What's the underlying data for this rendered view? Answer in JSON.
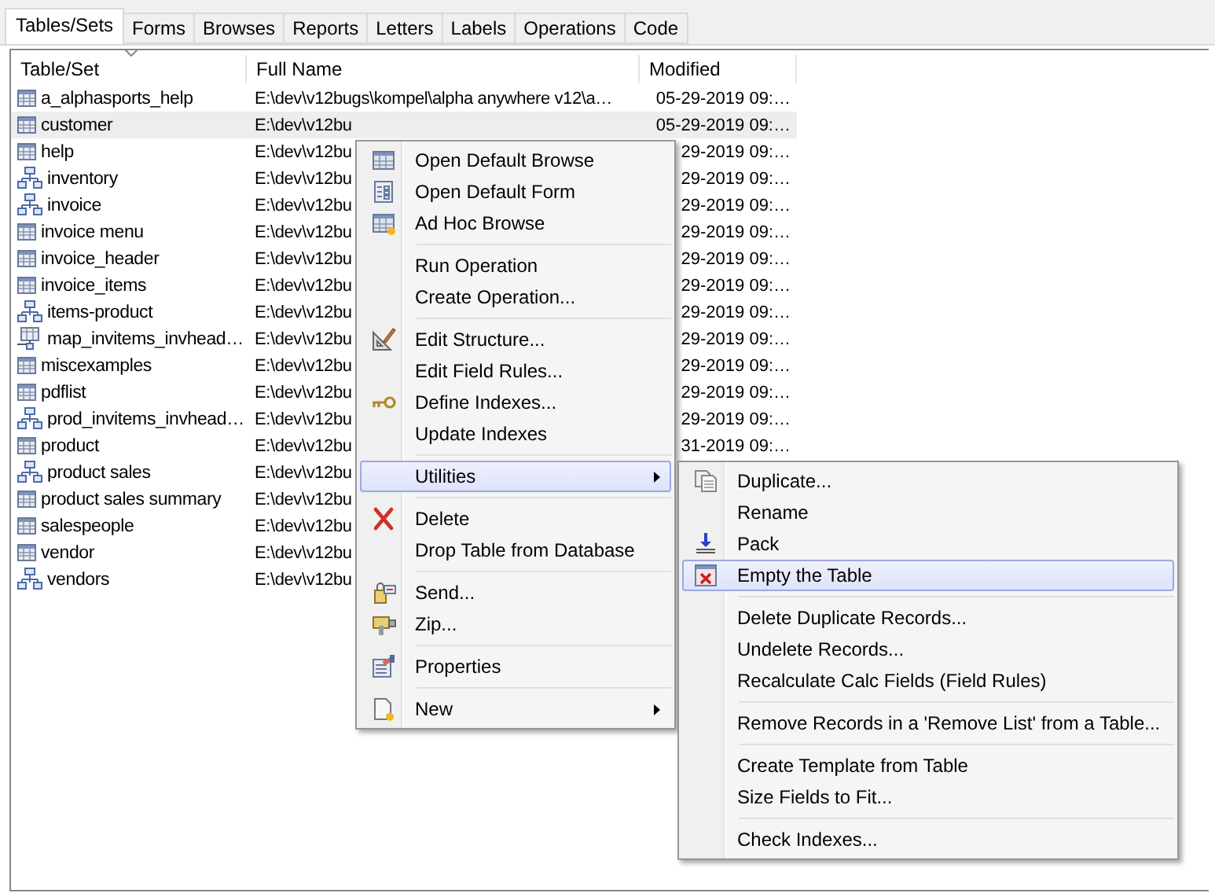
{
  "tabs": [
    {
      "label": "Tables/Sets",
      "selected": true
    },
    {
      "label": "Forms",
      "selected": false
    },
    {
      "label": "Browses",
      "selected": false
    },
    {
      "label": "Reports",
      "selected": false
    },
    {
      "label": "Letters",
      "selected": false
    },
    {
      "label": "Labels",
      "selected": false
    },
    {
      "label": "Operations",
      "selected": false
    },
    {
      "label": "Code",
      "selected": false
    }
  ],
  "table": {
    "columns": [
      "Table/Set",
      "Full Name",
      "Modified"
    ],
    "rows": [
      {
        "kind": "table",
        "name": "a_alphasports_help",
        "full_name": "E:\\dev\\v12bugs\\kompel\\alpha anywhere v12\\a…",
        "modified": "05-29-2019 09:…",
        "selected": false
      },
      {
        "kind": "table",
        "name": "customer",
        "full_name": "E:\\dev\\v12bu",
        "modified": "05-29-2019 09:…",
        "selected": true
      },
      {
        "kind": "table",
        "name": "help",
        "full_name": "E:\\dev\\v12bu",
        "modified": "29-2019 09:…",
        "selected": false
      },
      {
        "kind": "set",
        "name": "inventory",
        "full_name": "E:\\dev\\v12bu",
        "modified": "29-2019 09:…",
        "selected": false
      },
      {
        "kind": "set",
        "name": "invoice",
        "full_name": "E:\\dev\\v12bu",
        "modified": "29-2019 09:…",
        "selected": false
      },
      {
        "kind": "table",
        "name": "invoice menu",
        "full_name": "E:\\dev\\v12bu",
        "modified": "29-2019 09:…",
        "selected": false
      },
      {
        "kind": "table",
        "name": "invoice_header",
        "full_name": "E:\\dev\\v12bu",
        "modified": "29-2019 09:…",
        "selected": false
      },
      {
        "kind": "table",
        "name": "invoice_items",
        "full_name": "E:\\dev\\v12bu",
        "modified": "29-2019 09:…",
        "selected": false
      },
      {
        "kind": "set",
        "name": "items-product",
        "full_name": "E:\\dev\\v12bu",
        "modified": "29-2019 09:…",
        "selected": false
      },
      {
        "kind": "map",
        "name": "map_invitems_invhead…",
        "full_name": "E:\\dev\\v12bu",
        "modified": "29-2019 09:…",
        "selected": false
      },
      {
        "kind": "table",
        "name": "miscexamples",
        "full_name": "E:\\dev\\v12bu",
        "modified": "29-2019 09:…",
        "selected": false
      },
      {
        "kind": "table",
        "name": "pdflist",
        "full_name": "E:\\dev\\v12bu",
        "modified": "29-2019 09:…",
        "selected": false
      },
      {
        "kind": "set",
        "name": "prod_invitems_invhead…",
        "full_name": "E:\\dev\\v12bu",
        "modified": "29-2019 09:…",
        "selected": false
      },
      {
        "kind": "table",
        "name": "product",
        "full_name": "E:\\dev\\v12bu",
        "modified": "31-2019 09:…",
        "selected": false
      },
      {
        "kind": "set",
        "name": "product sales",
        "full_name": "E:\\dev\\v12bu",
        "selected": false
      },
      {
        "kind": "table",
        "name": "product sales summary",
        "full_name": "E:\\dev\\v12bu",
        "selected": false
      },
      {
        "kind": "table",
        "name": "salespeople",
        "full_name": "E:\\dev\\v12bu",
        "selected": false
      },
      {
        "kind": "table",
        "name": "vendor",
        "full_name": "E:\\dev\\v12bu",
        "selected": false
      },
      {
        "kind": "set",
        "name": "vendors",
        "full_name": "E:\\dev\\v12bu",
        "selected": false
      }
    ]
  },
  "context_menu": {
    "groups": [
      [
        {
          "label": "Open Default Browse",
          "selected": false,
          "submenu": false
        },
        {
          "label": "Open Default Form",
          "selected": false,
          "submenu": false
        },
        {
          "label": "Ad Hoc Browse",
          "selected": false,
          "submenu": false
        }
      ],
      [
        {
          "label": "Run Operation",
          "selected": false,
          "submenu": false
        },
        {
          "label": "Create Operation...",
          "selected": false,
          "submenu": false
        }
      ],
      [
        {
          "label": "Edit Structure...",
          "selected": false,
          "submenu": false
        },
        {
          "label": "Edit Field Rules...",
          "selected": false,
          "submenu": false
        },
        {
          "label": "Define Indexes...",
          "selected": false,
          "submenu": false
        },
        {
          "label": "Update Indexes",
          "selected": false,
          "submenu": false
        }
      ],
      [
        {
          "label": "Utilities",
          "selected": true,
          "submenu": true
        }
      ],
      [
        {
          "label": "Delete",
          "selected": false,
          "submenu": false
        },
        {
          "label": "Drop Table from Database",
          "selected": false,
          "submenu": false
        }
      ],
      [
        {
          "label": "Send...",
          "selected": false,
          "submenu": false
        },
        {
          "label": "Zip...",
          "selected": false,
          "submenu": false
        }
      ],
      [
        {
          "label": "Properties",
          "selected": false,
          "submenu": false
        }
      ],
      [
        {
          "label": "New",
          "selected": false,
          "submenu": true
        }
      ]
    ]
  },
  "submenu": {
    "groups": [
      [
        {
          "label": "Duplicate...",
          "selected": false,
          "submenu": false
        },
        {
          "label": "Rename",
          "selected": false,
          "submenu": false
        },
        {
          "label": "Pack",
          "selected": false,
          "submenu": false
        },
        {
          "label": "Empty the Table",
          "selected": true,
          "submenu": false
        }
      ],
      [
        {
          "label": "Delete Duplicate Records...",
          "selected": false,
          "submenu": false
        },
        {
          "label": "Undelete Records...",
          "selected": false,
          "submenu": false
        },
        {
          "label": "Recalculate Calc Fields (Field Rules)",
          "selected": false,
          "submenu": false
        }
      ],
      [
        {
          "label": "Remove Records in a 'Remove List' from a Table...",
          "selected": false,
          "submenu": false
        }
      ],
      [
        {
          "label": "Create Template from Table",
          "selected": false,
          "submenu": false
        },
        {
          "label": "Size Fields to Fit...",
          "selected": false,
          "submenu": false
        }
      ],
      [
        {
          "label": "Check Indexes...",
          "selected": false,
          "submenu": false
        }
      ]
    ]
  }
}
